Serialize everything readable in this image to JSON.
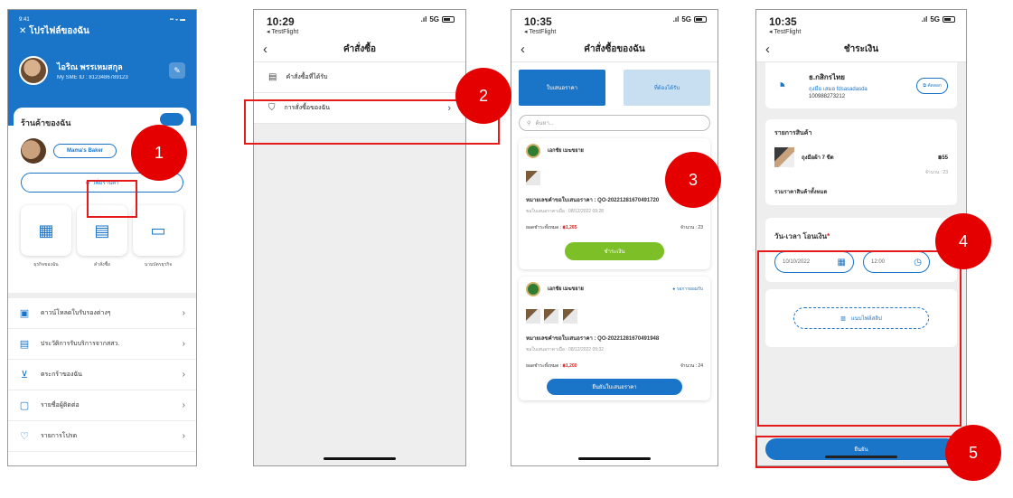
{
  "screen1": {
    "status_time": "9:41",
    "header_title": "โปรไฟล์ของฉัน",
    "profile_name": "ไอริณ พรรเหมสกุล",
    "profile_id": "My SME ID : 8123486789123",
    "shop_title": "ร้านค้าของฉัน",
    "shop_name": "Mama's Baker",
    "add_shop_label": "เพิ่มร้านค้า",
    "grid": [
      {
        "label": "ธุรกิจของฉัน",
        "icon": "store-icon"
      },
      {
        "label": "คำสั่งซื้อ",
        "icon": "clipboard-icon"
      },
      {
        "label": "นามบัตรธุรกิจ",
        "icon": "card-icon"
      }
    ],
    "menu": [
      {
        "label": "ดาวน์โหลดใบรับรองต่างๆ",
        "icon": "download-doc-icon"
      },
      {
        "label": "ประวัติการรับบริการจากสสว.",
        "icon": "history-icon"
      },
      {
        "label": "ตระกร้าของฉัน",
        "icon": "cart-icon"
      },
      {
        "label": "รายชื่อผู้ติดต่อ",
        "icon": "contact-icon"
      },
      {
        "label": "รายการโปรด",
        "icon": "heart-icon"
      }
    ]
  },
  "screen2": {
    "status_time": "10:29",
    "status_back_app": "◂ TestFlight",
    "signal": "5G",
    "nav_title": "คำสั่งซื้อ",
    "rows": [
      {
        "label": "คำสั่งซื้อที่ได้รับ"
      },
      {
        "label": "การสั่งซื้อของฉัน"
      }
    ]
  },
  "screen3": {
    "status_time": "10:35",
    "status_back_app": "◂ TestFlight",
    "signal": "5G",
    "nav_title": "คำสั่งซื้อของฉัน",
    "tab_active": "ใบเสนอราคา",
    "tab_inactive": "ที่ต้องได้รับ",
    "search_placeholder": "ค้นหา...",
    "cards": [
      {
        "seller": "เอกชัย เมฆขยาย",
        "quote_line": "หมายเลขคำขอใบเสนอราคา : QO-20221281670491720",
        "date_line": "ขอใบเสนอราคาเมื่อ : 08/12/2022 09:28",
        "total_label": "ยอดชำระทั้งหมด : ",
        "total_value": "฿1,265",
        "qty": "จำนวน : 23",
        "button": "ชำระเงิน"
      },
      {
        "seller": "เอกชัย เมฆขยาย",
        "status": "รอการยอมรับ",
        "quote_line": "หมายเลขคำขอใบเสนอราคา : QO-20221281670491948",
        "date_line": "ขอใบเสนอราคาเมื่อ : 08/12/2022 09:32",
        "total_label": "ยอดชำระทั้งหมด : ",
        "total_value": "฿1,200",
        "qty": "จำนวน : 24",
        "button": "ยืนยันใบเสนอราคา"
      }
    ]
  },
  "screen4": {
    "status_time": "10:35",
    "status_back_app": "◂ TestFlight",
    "signal": "5G",
    "nav_title": "ชำระเงิน",
    "bank_name": "ธ.กสิกรไทย",
    "account_name": "ถุงมือ เสมอ fdsasadasda",
    "account_no": "100988273212",
    "copy_label": "คัดลอก",
    "products_title": "รายการสินค้า",
    "product_name": "ถุงมือผ้า 7 ขีด",
    "product_price": "฿55",
    "product_qty": "จำนวน : 23",
    "total_label": "รวมราคาสินค้าทั้งหมด",
    "datetime_title": "วัน-เวลา โอนเงิน",
    "required_mark": "*",
    "date_value": "10/10/2022",
    "time_value": "12:00",
    "upload_label": "แนบไฟล์สลิป",
    "confirm_label": "ยืนยัน"
  },
  "callouts": [
    "1",
    "2",
    "3",
    "4",
    "5"
  ],
  "colors": {
    "primary": "#1a75c8",
    "highlight": "#e41b1b",
    "pay_green": "#7cbf26"
  }
}
